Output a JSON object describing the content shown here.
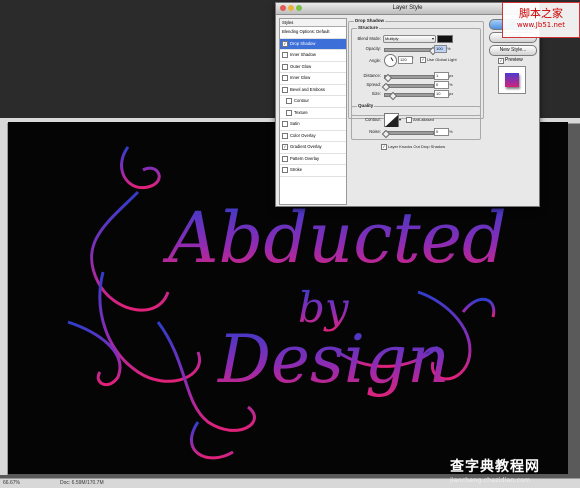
{
  "dialog": {
    "title": "Layer Style",
    "styles_header": "Styles",
    "styles_list": [
      {
        "label": "Blending Options: Default",
        "checkbox": false,
        "checked": false,
        "selected": false,
        "indent": false
      },
      {
        "label": "Drop Shadow",
        "checkbox": true,
        "checked": true,
        "selected": true,
        "indent": false
      },
      {
        "label": "Inner Shadow",
        "checkbox": true,
        "checked": false,
        "selected": false,
        "indent": false
      },
      {
        "label": "Outer Glow",
        "checkbox": true,
        "checked": false,
        "selected": false,
        "indent": false
      },
      {
        "label": "Inner Glow",
        "checkbox": true,
        "checked": false,
        "selected": false,
        "indent": false
      },
      {
        "label": "Bevel and Emboss",
        "checkbox": true,
        "checked": false,
        "selected": false,
        "indent": false
      },
      {
        "label": "Contour",
        "checkbox": true,
        "checked": false,
        "selected": false,
        "indent": true
      },
      {
        "label": "Texture",
        "checkbox": true,
        "checked": false,
        "selected": false,
        "indent": true
      },
      {
        "label": "Satin",
        "checkbox": true,
        "checked": false,
        "selected": false,
        "indent": false
      },
      {
        "label": "Color Overlay",
        "checkbox": true,
        "checked": false,
        "selected": false,
        "indent": false
      },
      {
        "label": "Gradient Overlay",
        "checkbox": true,
        "checked": true,
        "selected": false,
        "indent": false
      },
      {
        "label": "Pattern Overlay",
        "checkbox": true,
        "checked": false,
        "selected": false,
        "indent": false
      },
      {
        "label": "Stroke",
        "checkbox": true,
        "checked": false,
        "selected": false,
        "indent": false
      }
    ],
    "section_title": "Drop Shadow",
    "structure_label": "Structure",
    "blend_mode_label": "Blend Mode:",
    "blend_mode_value": "Multiply",
    "opacity_label": "Opacity:",
    "opacity_value": "100",
    "opacity_unit": "%",
    "angle_label": "Angle:",
    "angle_value": "120",
    "angle_unit": "°",
    "global_light_label": "Use Global Light",
    "distance_label": "Distance:",
    "distance_value": "1",
    "distance_unit": "px",
    "spread_label": "Spread:",
    "spread_value": "0",
    "spread_unit": "%",
    "size_label": "Size:",
    "size_value": "10",
    "size_unit": "px",
    "quality_label": "Quality",
    "contour_label": "Contour:",
    "antialiased_label": "Anti-aliased",
    "noise_label": "Noise:",
    "noise_value": "0",
    "noise_unit": "%",
    "knockout_label": "Layer Knocks Out Drop Shadow",
    "ok_label": "OK",
    "cancel_label": "Cancel",
    "new_style_label": "New Style...",
    "preview_label": "Preview"
  },
  "status": {
    "zoom": "66.67%",
    "doc": "Doc: 6.59M/170.7M"
  },
  "artwork": {
    "line1": "Abducted",
    "line2": "by",
    "line3": "Design"
  },
  "watermarks": {
    "top": "脚本之家",
    "top_url": "www.Jb51.net",
    "bottom": "查字典教程网",
    "bottom_url": "jiaocheng.chazidian.com"
  },
  "colors": {
    "accent": "#3d6fd8",
    "gradient_top": "#2e3fc7",
    "gradient_bottom": "#e0227a",
    "shadow_color": "#111111"
  }
}
